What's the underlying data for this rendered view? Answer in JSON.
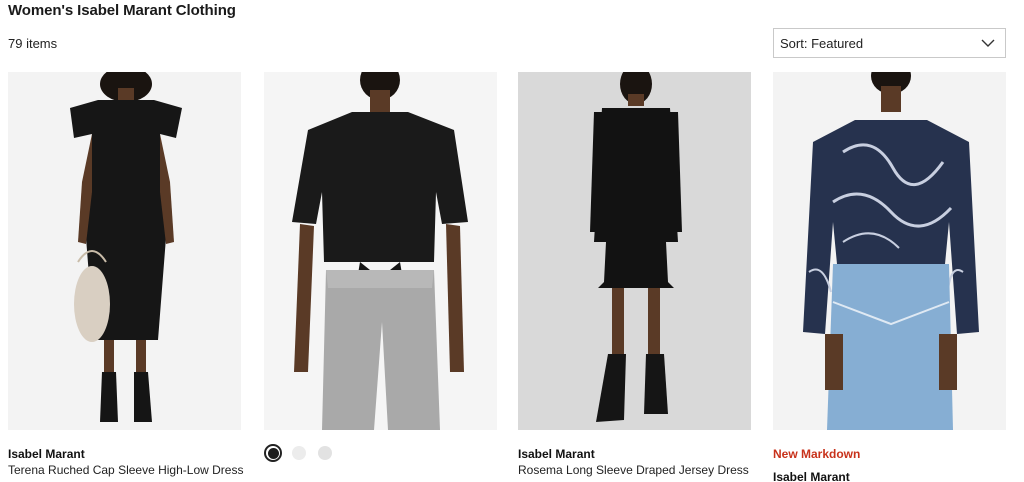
{
  "page": {
    "title": "Women's Isabel Marant Clothing",
    "item_count": "79 items"
  },
  "sort": {
    "label": "Sort: Featured",
    "icon": "chevron-down-icon"
  },
  "colors": {
    "markdown_red": "#c8321b",
    "swatch_black": "#1c1c1c",
    "swatch_light_gray": "#ececec",
    "swatch_mid_gray": "#e2e2e2"
  },
  "products": [
    {
      "brand": "Isabel Marant",
      "name": "Terena Ruched Cap Sleeve High-Low Dress",
      "badge": ""
    },
    {
      "brand": "",
      "name": "",
      "badge": "",
      "swatches": [
        {
          "color": "#1c1c1c",
          "selected": true
        },
        {
          "color": "#ececec",
          "selected": false
        },
        {
          "color": "#e2e2e2",
          "selected": false
        }
      ]
    },
    {
      "brand": "Isabel Marant",
      "name": "Rosema Long Sleeve Draped Jersey Dress",
      "badge": ""
    },
    {
      "brand": "Isabel Marant",
      "name": "",
      "badge": "New Markdown"
    }
  ]
}
